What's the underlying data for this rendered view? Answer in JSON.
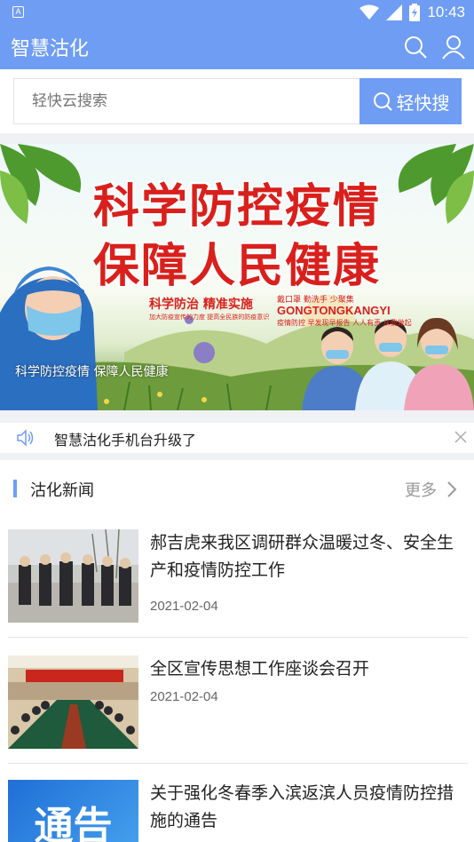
{
  "status_bar": {
    "time": "10:43",
    "left_icon": "A"
  },
  "app_bar": {
    "title": "智慧沽化"
  },
  "search": {
    "placeholder": "轻快云搜索",
    "button_label": "轻快搜"
  },
  "banner": {
    "headline_line1": "科学防控疫情",
    "headline_line2": "保障人民健康",
    "slogan_main": "科学防治 精准实施",
    "slogan_main_sub": "加大防疫宣传的力度 提高全民族的防疫意识",
    "slogan_right_top": "戴口罩 勤洗手 少聚集",
    "slogan_right_mid": "GONGTONGKANGYI",
    "slogan_right_bottom": "疫情防控 早发现早报告 人人有责 从我做起",
    "caption": "科学防控疫情   保障人民健康"
  },
  "notice": {
    "text": "智慧沽化手机台升级了"
  },
  "news": {
    "section_title": "沽化新闻",
    "more_label": "更多",
    "items": [
      {
        "title": "郝吉虎来我区调研群众温暖过冬、安全生产和疫情防控工作",
        "date": "2021-02-04"
      },
      {
        "title": "全区宣传思想工作座谈会召开",
        "date": "2021-02-04"
      },
      {
        "title": "关于强化冬春季入滨返滨人员疫情防控措施的通告",
        "date": ""
      }
    ],
    "thumb3_text": "通告"
  },
  "colors": {
    "brand": "#6f9df4",
    "alert_red": "#d9201c"
  }
}
